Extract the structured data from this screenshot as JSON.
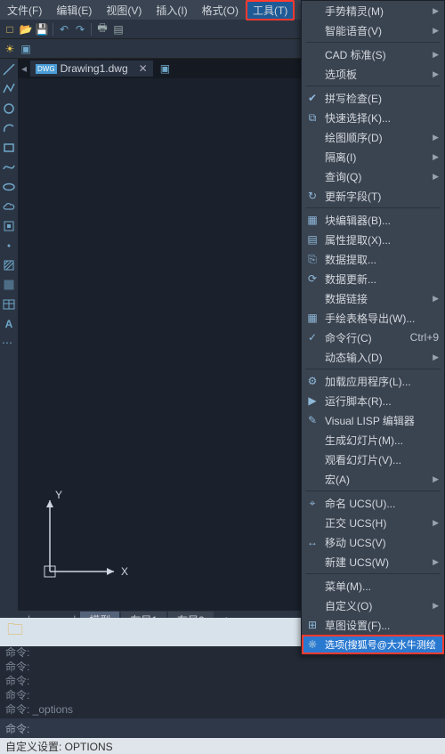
{
  "menubar": [
    "文件(F)",
    "编辑(E)",
    "视图(V)",
    "插入(I)",
    "格式(O)",
    "工具(T)"
  ],
  "menubar_active_index": 5,
  "document_tab": "Drawing1.dwg",
  "ucs": {
    "x_label": "X",
    "y_label": "Y"
  },
  "layout_tabs": {
    "active": "模型",
    "others": [
      "布局1",
      "布局2"
    ]
  },
  "command_lines": [
    "命令:",
    "命令:",
    "命令:",
    "命令:",
    "命令:",
    "命令: _options"
  ],
  "command_prompt": "命令:",
  "command_input": "",
  "status_text": "自定义设置: OPTIONS",
  "dropdown": [
    {
      "label": "手势精灵(M)",
      "submenu": true
    },
    {
      "label": "智能语音(V)",
      "submenu": true
    },
    {
      "sep": true
    },
    {
      "label": "CAD 标准(S)",
      "submenu": true
    },
    {
      "label": "选项板",
      "submenu": true
    },
    {
      "sep": true
    },
    {
      "label": "拼写检查(E)",
      "icon": "abc"
    },
    {
      "label": "快速选择(K)...",
      "icon": "sel"
    },
    {
      "label": "绘图顺序(D)",
      "submenu": true
    },
    {
      "label": "隔离(I)",
      "submenu": true
    },
    {
      "label": "查询(Q)",
      "submenu": true
    },
    {
      "label": "更新字段(T)",
      "icon": "upd"
    },
    {
      "sep": true
    },
    {
      "label": "块编辑器(B)...",
      "icon": "blk"
    },
    {
      "label": "属性提取(X)...",
      "icon": "attr"
    },
    {
      "label": "数据提取...",
      "icon": "data"
    },
    {
      "label": "数据更新...",
      "icon": "dup"
    },
    {
      "label": "数据链接",
      "submenu": true
    },
    {
      "label": "手绘表格导出(W)...",
      "icon": "tbl"
    },
    {
      "label": "命令行(C)",
      "shortcut": "Ctrl+9",
      "icon": "cmd"
    },
    {
      "label": "动态输入(D)",
      "submenu": true
    },
    {
      "sep": true
    },
    {
      "label": "加载应用程序(L)...",
      "icon": "app"
    },
    {
      "label": "运行脚本(R)...",
      "icon": "scr"
    },
    {
      "label": "Visual LISP 编辑器",
      "icon": "lsp"
    },
    {
      "label": "生成幻灯片(M)...",
      "submenu": false
    },
    {
      "label": "观看幻灯片(V)...",
      "submenu": false
    },
    {
      "label": "宏(A)",
      "submenu": true
    },
    {
      "sep": true
    },
    {
      "label": "命名 UCS(U)...",
      "icon": "ucs"
    },
    {
      "label": "正交 UCS(H)",
      "submenu": true
    },
    {
      "label": "移动 UCS(V)",
      "icon": "mucs"
    },
    {
      "label": "新建 UCS(W)",
      "submenu": true
    },
    {
      "sep": true
    },
    {
      "label": "菜单(M)...",
      "submenu": false
    },
    {
      "label": "自定义(O)",
      "submenu": true
    },
    {
      "label": "草图设置(F)...",
      "icon": "skt"
    },
    {
      "label": "选项(搜狐号@大水牛测绘",
      "icon": "opt",
      "highlight": true
    }
  ]
}
